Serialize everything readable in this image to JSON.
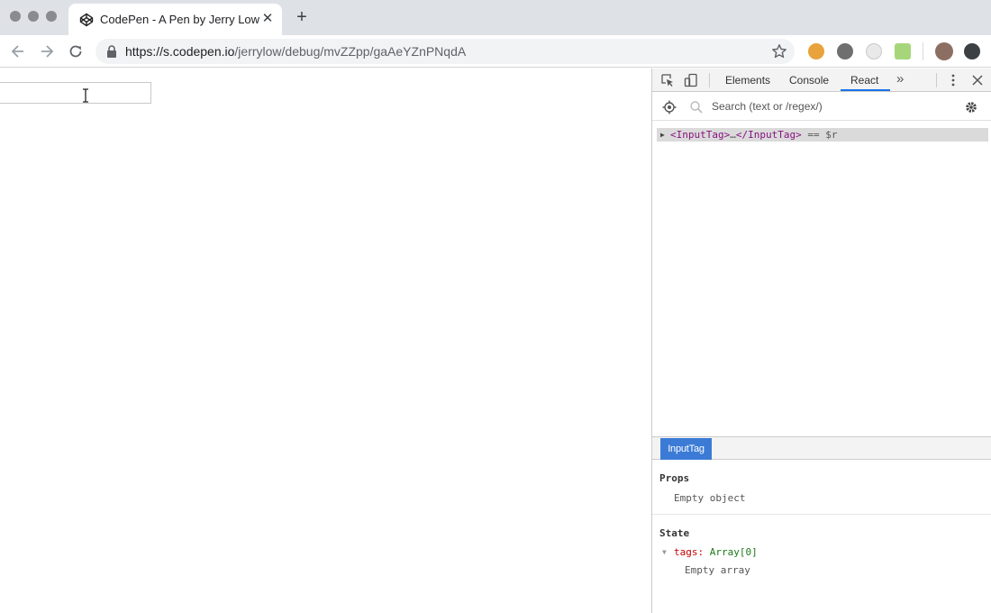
{
  "browser": {
    "tab_title": "CodePen - A Pen by Jerry Low",
    "tab_close": "✕",
    "new_tab": "+",
    "url_host": "https://s.codepen.io",
    "url_path": "/jerrylow/debug/mvZZpp/gaAeYZnPNqdA"
  },
  "devtools": {
    "tabs": [
      "Elements",
      "Console",
      "React"
    ],
    "active_tab": "React",
    "more": "»",
    "search_placeholder": "Search (text or /regex/)",
    "tree": {
      "open_tag": "<InputTag>",
      "ellipsis": "…",
      "close_tag": "</InputTag>",
      "ref": "== $r"
    },
    "detail_tab": "InputTag",
    "props_title": "Props",
    "props_value": "Empty object",
    "state_title": "State",
    "state_key": "tags:",
    "state_type": "Array[0]",
    "state_value": "Empty array"
  }
}
